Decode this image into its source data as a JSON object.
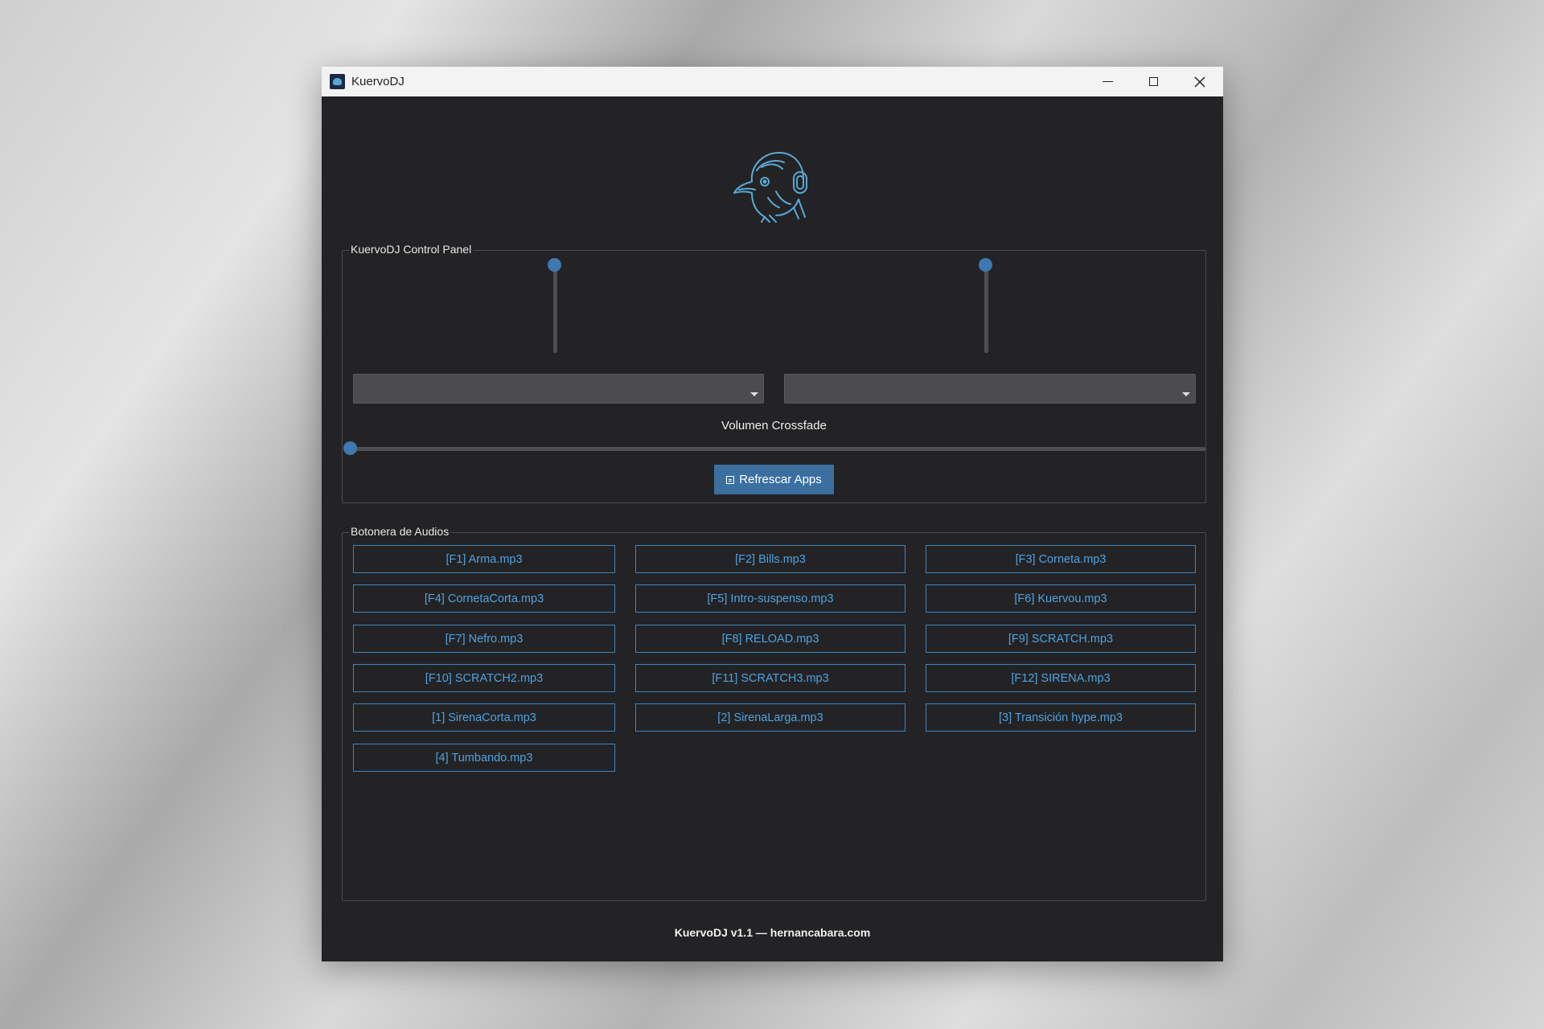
{
  "window": {
    "title": "KuervoDJ",
    "controls": {
      "minimize": "minimize-icon",
      "maximize": "maximize-icon",
      "close": "close-icon"
    }
  },
  "logo": {
    "icon": "crow-with-headphones-logo",
    "color": "#5aa8d6"
  },
  "control_panel": {
    "title": "KuervoDJ Control Panel",
    "left_volume_level": 1.0,
    "right_volume_level": 1.0,
    "left_app_select": "",
    "right_app_select": "",
    "crossfade_label": "Volumen Crossfade",
    "crossfade_level": 0.0,
    "refresh_button": {
      "label": "Refrescar Apps",
      "icon": "refresh-icon"
    }
  },
  "audios_panel": {
    "title": "Botonera de Audios",
    "buttons": [
      "[F1] Arma.mp3",
      "[F2] Bills.mp3",
      "[F3] Corneta.mp3",
      "[F4] CornetaCorta.mp3",
      "[F5] Intro-suspenso.mp3",
      "[F6] Kuervou.mp3",
      "[F7] Nefro.mp3",
      "[F8] RELOAD.mp3",
      "[F9] SCRATCH.mp3",
      "[F10] SCRATCH2.mp3",
      "[F11] SCRATCH3.mp3",
      "[F12] SIRENA.mp3",
      "[1] SirenaCorta.mp3",
      "[2] SirenaLarga.mp3",
      "[3] Transición hype.mp3",
      "[4] Tumbando.mp3"
    ]
  },
  "footer": {
    "text": "KuervoDJ v1.1 — hernancabara.com"
  },
  "colors": {
    "accent": "#3e78b0",
    "button_text": "#4ea2e0",
    "background": "#232325"
  }
}
